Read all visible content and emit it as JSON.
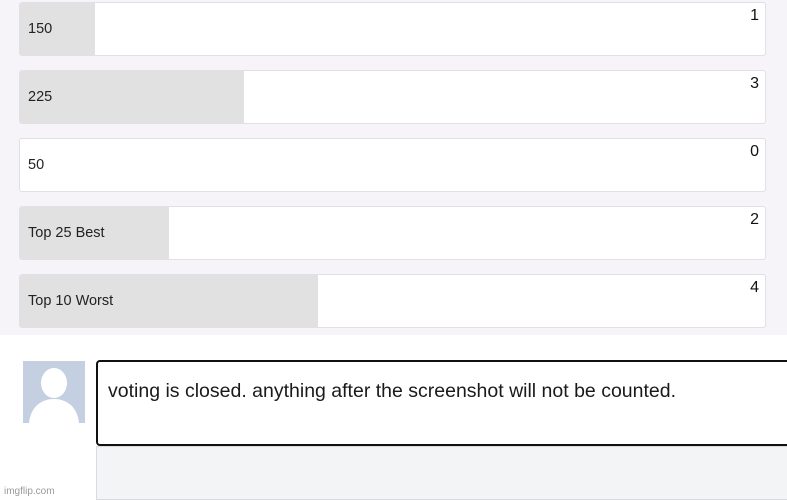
{
  "poll": {
    "options": [
      {
        "label": "150",
        "votes": "1",
        "share": 0.1
      },
      {
        "label": "225",
        "votes": "3",
        "share": 0.3
      },
      {
        "label": "50",
        "votes": "0",
        "share": 0
      },
      {
        "label": "Top 25 Best",
        "votes": "2",
        "share": 0.2
      },
      {
        "label": "Top 10 Worst",
        "votes": "4",
        "share": 0.4
      }
    ]
  },
  "comment": {
    "text": "voting is closed. anything after the screenshot will not be counted."
  },
  "watermark": "imgflip.com",
  "colors": {
    "panel_bg": "#f6f3f9",
    "bar_fill": "#e1e1e1",
    "avatar_bg": "#c5cfe2",
    "comment_border": "#111111"
  }
}
